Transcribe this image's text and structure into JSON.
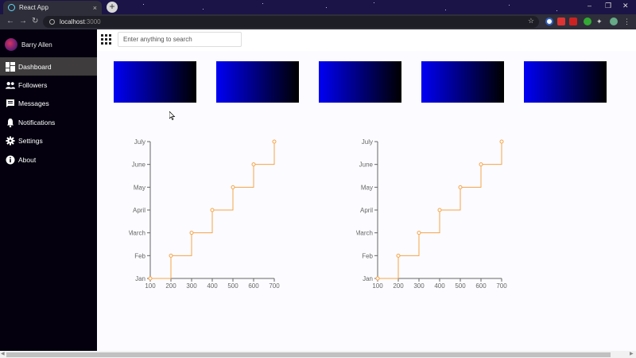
{
  "browser": {
    "tab_title": "React App",
    "tab_close": "×",
    "new_tab": "+",
    "url_host": "localhost",
    "url_port": ":3000",
    "back": "←",
    "forward": "→",
    "reload": "↻",
    "bookmark": "☆",
    "minimize": "–",
    "maximize": "❐",
    "close": "✕"
  },
  "user": {
    "name": "Barry Allen"
  },
  "sidebar": {
    "items": [
      {
        "label": "Dashboard",
        "icon": "dashboard-icon",
        "active": true
      },
      {
        "label": "Followers",
        "icon": "followers-icon",
        "active": false
      },
      {
        "label": "Messages",
        "icon": "messages-icon",
        "active": false
      },
      {
        "label": "Notifications",
        "icon": "bell-icon",
        "active": false
      },
      {
        "label": "Settings",
        "icon": "gear-icon",
        "active": false
      },
      {
        "label": "About",
        "icon": "info-icon",
        "active": false
      }
    ]
  },
  "search": {
    "placeholder": "Enter anything to search",
    "value": ""
  },
  "cards": {
    "count": 5,
    "gradient_start": "#0000f4",
    "gradient_end": "#000000"
  },
  "colors": {
    "sidebar_bg": "#04000e",
    "active_item": "#3e3c3c",
    "line": "#f4a44a"
  },
  "chart_data": [
    {
      "type": "line",
      "step": "after",
      "x": [
        100,
        200,
        300,
        400,
        500,
        600,
        700
      ],
      "y": [
        "Jan",
        "Feb",
        "March",
        "April",
        "May",
        "June",
        "July"
      ],
      "x_ticks": [
        "100",
        "200",
        "300",
        "400",
        "500",
        "600",
        "700"
      ],
      "y_ticks": [
        "Jan",
        "Feb",
        "March",
        "April",
        "May",
        "June",
        "July"
      ],
      "xlim": [
        100,
        700
      ]
    },
    {
      "type": "line",
      "step": "after",
      "x": [
        100,
        200,
        300,
        400,
        500,
        600,
        700
      ],
      "y": [
        "Jan",
        "Feb",
        "March",
        "April",
        "May",
        "June",
        "July"
      ],
      "x_ticks": [
        "100",
        "200",
        "300",
        "400",
        "500",
        "600",
        "700"
      ],
      "y_ticks": [
        "Jan",
        "Feb",
        "March",
        "April",
        "May",
        "June",
        "July"
      ],
      "xlim": [
        100,
        700
      ]
    }
  ]
}
